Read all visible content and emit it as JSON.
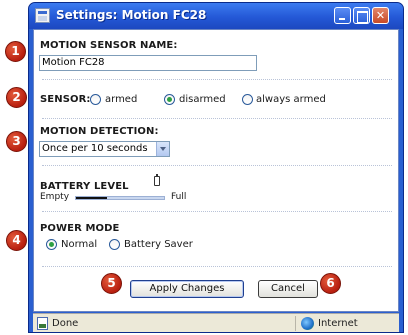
{
  "window": {
    "title": "Settings: Motion FC28"
  },
  "callouts": [
    "1",
    "2",
    "3",
    "4",
    "5",
    "6"
  ],
  "motion_sensor_name": {
    "label": "MOTION SENSOR NAME:",
    "value": "Motion FC28"
  },
  "sensor": {
    "label": "SENSOR:",
    "options": [
      {
        "label": "armed",
        "checked": false
      },
      {
        "label": "disarmed",
        "checked": true
      },
      {
        "label": "always armed",
        "checked": false
      }
    ]
  },
  "motion_detection": {
    "label": "MOTION DETECTION:",
    "selected": "Once per 10 seconds"
  },
  "battery": {
    "label": "BATTERY LEVEL",
    "empty_label": "Empty",
    "full_label": "Full",
    "level_fraction": 0.35
  },
  "power_mode": {
    "label": "POWER MODE",
    "options": [
      {
        "label": "Normal",
        "checked": true
      },
      {
        "label": "Battery Saver",
        "checked": false
      }
    ]
  },
  "buttons": {
    "apply_label": "Apply Changes",
    "cancel_label": "Cancel"
  },
  "status_bar": {
    "left_text": "Done",
    "zone_text": "Internet"
  },
  "colors": {
    "titlebar": "#2458d6",
    "callout": "#c3240f",
    "radio_checked": "#2ea043"
  }
}
